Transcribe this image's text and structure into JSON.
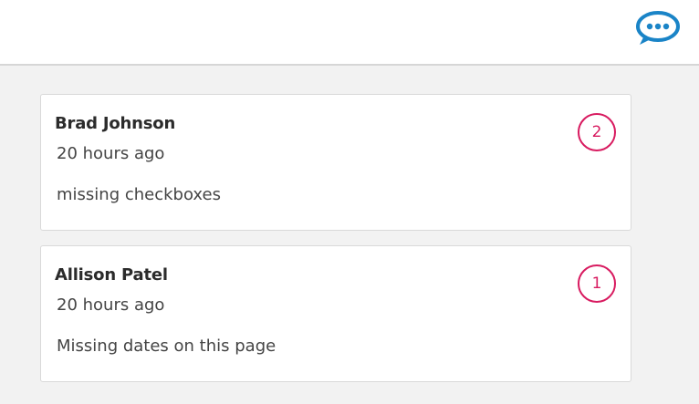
{
  "header": {
    "chat_icon": "speech-bubble-icon",
    "accent_color": "#1a84c7"
  },
  "comments": [
    {
      "author": "Brad Johnson",
      "time": "20 hours ago",
      "text": "missing checkboxes",
      "badge": "2"
    },
    {
      "author": "Allison Patel",
      "time": "20 hours ago",
      "text": "Missing dates on this page",
      "badge": "1"
    }
  ],
  "badge_color": "#d81b60"
}
